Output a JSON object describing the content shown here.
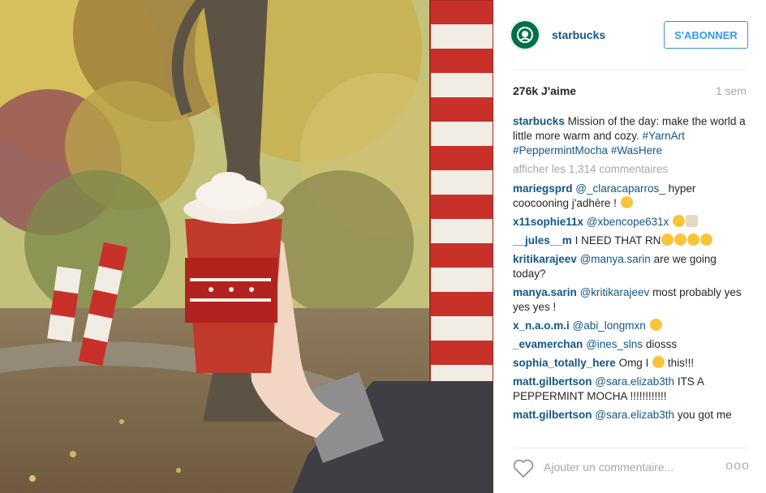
{
  "account": {
    "username": "starbucks",
    "follow_label": "S'ABONNER"
  },
  "post": {
    "likes": "276k J'aime",
    "time": "1 sem"
  },
  "caption": {
    "user": "starbucks",
    "text": "Mission of the day: make the world a little more warm and cozy.",
    "tags": [
      "#YarnArt",
      "#PeppermintMocha",
      "#WasHere"
    ]
  },
  "view_all": "afficher les 1,314 commentaires",
  "comments": [
    {
      "user": "mariegsprd",
      "mention": "@_claracaparros_",
      "text": "hyper coocooning j'adhère !"
    },
    {
      "user": "x11sophie11x",
      "mention": "@xbencope631x",
      "text": ""
    },
    {
      "user": "__jules__m",
      "mention": "",
      "text": "I NEED THAT RN"
    },
    {
      "user": "kritikarajeev",
      "mention": "@manya.sarin",
      "text": "are we going today?"
    },
    {
      "user": "manya.sarin",
      "mention": "@kritikarajeev",
      "text": "most probably yes yes yes !"
    },
    {
      "user": "x_n.a.o.m.i",
      "mention": "@abi_longmxn",
      "text": ""
    },
    {
      "user": "_evamerchan",
      "mention": "@ines_slns",
      "text": "diosss"
    },
    {
      "user": "sophia_totally_here",
      "mention": "",
      "text": "Omg I",
      "text2": "this!!!"
    },
    {
      "user": "matt.gilbertson",
      "mention": "@sara.elizab3th",
      "text": "ITS A PEPPERMINT MOCHA !!!!!!!!!!!!"
    },
    {
      "user": "matt.gilbertson",
      "mention": "@sara.elizab3th",
      "text": "you got me"
    }
  ],
  "add_comment_placeholder": "Ajouter un commentaire...",
  "more_options": "ooo",
  "icons": {
    "heart": "heart-icon",
    "logo": "starbucks-logo-icon",
    "more": "more-options-icon"
  },
  "colors": {
    "link": "#125688",
    "follow": "#3897f0",
    "muted": "#a5a7aa"
  }
}
